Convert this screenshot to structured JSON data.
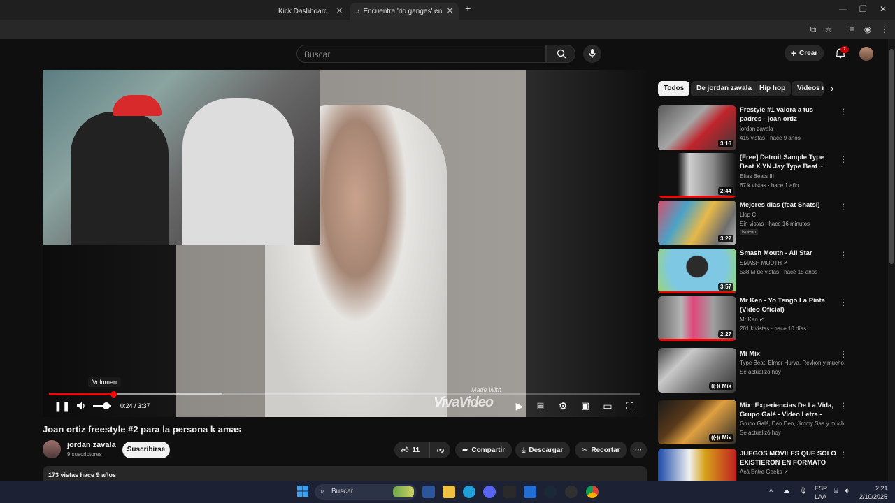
{
  "browser": {
    "tabs": [
      {
        "label": "Kick Dashboard"
      },
      {
        "label": "Encuentra 'rio ganges' en TikTo"
      }
    ],
    "new_tab": "+",
    "close_glyph": "✕"
  },
  "header": {
    "search_placeholder": "Buscar",
    "create_label": "Crear",
    "notification_count": "2"
  },
  "player": {
    "volume_tooltip": "Volumen",
    "time": "0:24 / 3:37",
    "progress_fraction": 0.11,
    "watermark_small": "Made With",
    "watermark_big": "VivaVideo"
  },
  "video": {
    "title": "Joan ortiz freestyle #2 para la persona k amas",
    "channel": "jordan zavala",
    "subscribers": "9 suscriptores",
    "subscribe_label": "Suscribirse",
    "likes": "11",
    "share_label": "Compartir",
    "download_label": "Descargar",
    "clip_label": "Recortar",
    "views_date": "173 vistas  hace 9 años"
  },
  "chips": [
    "Todos",
    "De jordan zavala",
    "Hip hop",
    "Videos r"
  ],
  "recommendations": [
    {
      "title": "Frestyle #1 valora a tus padres - joan ortiz",
      "channel": "jordan zavala",
      "meta": "415 vistas · hace 9 años",
      "duration": "3:16"
    },
    {
      "title": "[Free] Detroit Sample Type Beat X YN Jay Type Beat ~ \"Amores...",
      "channel": "Elias Beats III",
      "meta": "67 k vistas · hace 1 año",
      "duration": "2:44"
    },
    {
      "title": "Mejores dias (feat Shatsi)",
      "channel": "Llop C",
      "meta": "Sin vistas · hace 16 minutos",
      "badge": "Nuevo",
      "duration": "3:22"
    },
    {
      "title": "Smash Mouth - All Star",
      "channel": "SMASH MOUTH",
      "meta": "538 M de vistas · hace 15 años",
      "duration": "3:57"
    },
    {
      "title": "Mr Ken - Yo Tengo La Pinta (Video Oficial)",
      "channel": "Mr Ken",
      "meta": "201 k vistas · hace 10 días",
      "duration": "2:27"
    },
    {
      "title": "Mi Mix",
      "channel": "Type Beat, Elmer Hurva, Reykon y mucho...",
      "meta": "Se actualizó hoy",
      "duration": "Mix"
    },
    {
      "title": "Mix: Experiencias De La Vida, Grupo Galé - Video Letra - Sals...",
      "channel": "Grupo Galé, Dan Den, Jimmy Saa y much...",
      "meta": "Se actualizó hoy",
      "duration": "Mix"
    },
    {
      "title": "JUEGOS MOVILES QUE SOLO EXISTIERON EN FORMATO APK",
      "channel": "Acá Entre Geeks",
      "meta": "",
      "duration": ""
    }
  ],
  "taskbar": {
    "search_label": "Buscar",
    "lang_top": "ESP",
    "lang_bottom": "LAA",
    "time": "2:21",
    "date": "2/10/2025"
  },
  "colors": {
    "accent_red": "#ff0000",
    "bg": "#0f0f0f"
  }
}
